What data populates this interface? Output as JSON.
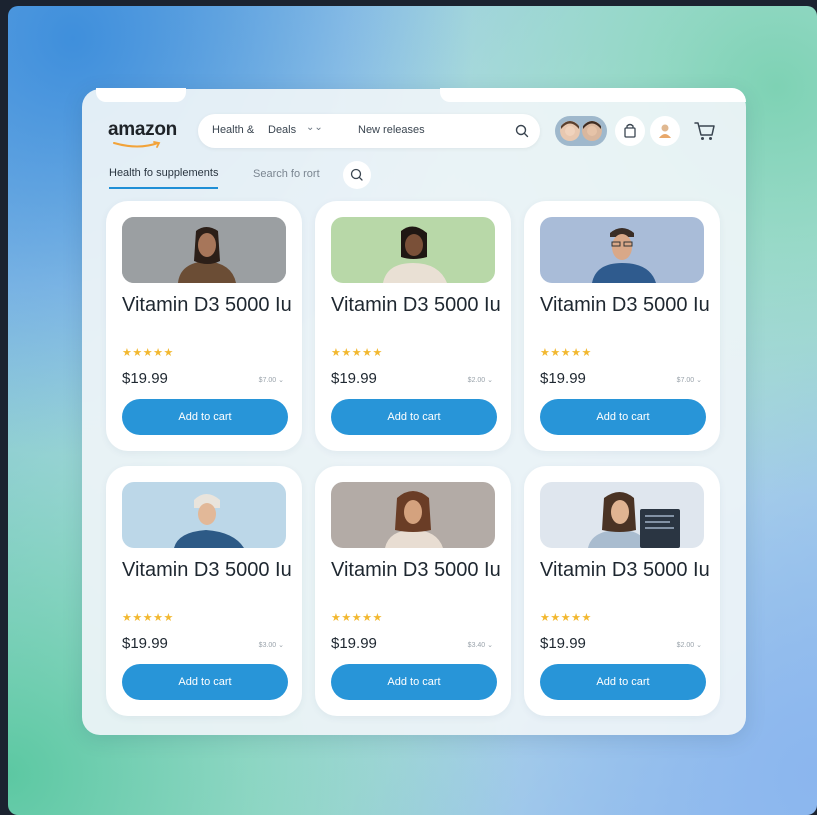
{
  "header": {
    "logo": "amazon",
    "nav": {
      "health": "Health &",
      "deals": "Deals",
      "new_releases": "New releases"
    }
  },
  "subnav": {
    "active_tab": "Health fo supplements",
    "search_placeholder": "Search fo rort"
  },
  "products": [
    {
      "name": "Vitamin D3 5000 Iu",
      "stars": "★★★★★",
      "price": "$19.99",
      "old_price": "$7.00 ⌄",
      "button": "Add to cart",
      "thumb_bg": "#9b9fa2"
    },
    {
      "name": "Vitamin D3 5000 Iu",
      "stars": "★★★★★",
      "price": "$19.99",
      "old_price": "$2.00 ⌄",
      "button": "Add to cart",
      "thumb_bg": "#b8d8a8"
    },
    {
      "name": "Vitamin D3 5000 Iu",
      "stars": "★★★★★",
      "price": "$19.99",
      "old_price": "$7.00 ⌄",
      "button": "Add to cart",
      "thumb_bg": "#a9bcd8"
    },
    {
      "name": "Vitamin D3 5000 Iu",
      "stars": "★★★★★",
      "price": "$19.99",
      "old_price": "$3.00 ⌄",
      "button": "Add to cart",
      "thumb_bg": "#bcd7e8"
    },
    {
      "name": "Vitamin D3 5000 Iu",
      "stars": "★★★★★",
      "price": "$19.99",
      "old_price": "$3.40 ⌄",
      "button": "Add to cart",
      "thumb_bg": "#b3aba6"
    },
    {
      "name": "Vitamin D3 5000 Iu",
      "stars": "★★★★★",
      "price": "$19.99",
      "old_price": "$2.00 ⌄",
      "button": "Add to cart",
      "thumb_bg": "#dfe6ee"
    }
  ],
  "colors": {
    "accent": "#2895d8",
    "star": "#f2b830",
    "logo_smile": "#f2a33a"
  }
}
